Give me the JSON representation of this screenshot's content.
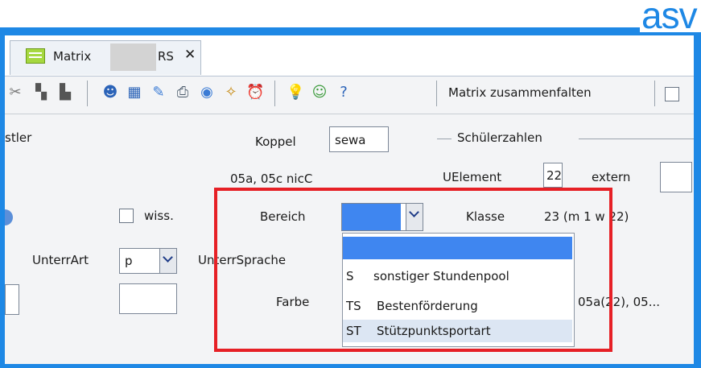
{
  "brand": {
    "logo_text": "asv"
  },
  "tab": {
    "label_prefix": "Matrix",
    "label_suffix": "RS",
    "close": "✕"
  },
  "toolbar": {
    "matrix_fold_label": "Matrix zusammenfalten",
    "icons": [
      "scissors-icon",
      "copy-icon",
      "paste-icon",
      "user-edit-icon",
      "chart-icon",
      "edit-note-icon",
      "print-icon",
      "eye-icon",
      "broom-icon",
      "alarm-clock-icon",
      "lightbulb-icon",
      "users-icon",
      "help-icon"
    ]
  },
  "form": {
    "left_partial_label": "stler",
    "koppel_label": "Koppel",
    "koppel_value": "sewa",
    "schuelerzahlen_title": "Schülerzahlen",
    "classes_text": "05a, 05c nicC",
    "uelement_label": "UElement",
    "uelement_value": "22",
    "extern_label": "extern",
    "wiss_label": "wiss.",
    "bereich_label": "Bereich",
    "klasse_label": "Klasse",
    "klasse_value": "23 (m 1 w 22)",
    "unterrart_label": "UnterrArt",
    "unterrart_value": "p",
    "unterrsprache_label": "UnterrSprache",
    "farbe_label": "Farbe",
    "right_partial": "05a(22), 05..."
  },
  "bereich_dropdown": {
    "selected": "",
    "options": [
      {
        "code": "",
        "text": ""
      },
      {
        "code": "S",
        "text": "sonstiger Stundenpool"
      },
      {
        "code": "TS",
        "text": "Bestenförderung"
      },
      {
        "code": "ST",
        "text": "Stützpunktsportart"
      }
    ]
  },
  "colors": {
    "accent": "#1e88e5",
    "highlight": "#e62026",
    "selection": "#3f86f0"
  }
}
